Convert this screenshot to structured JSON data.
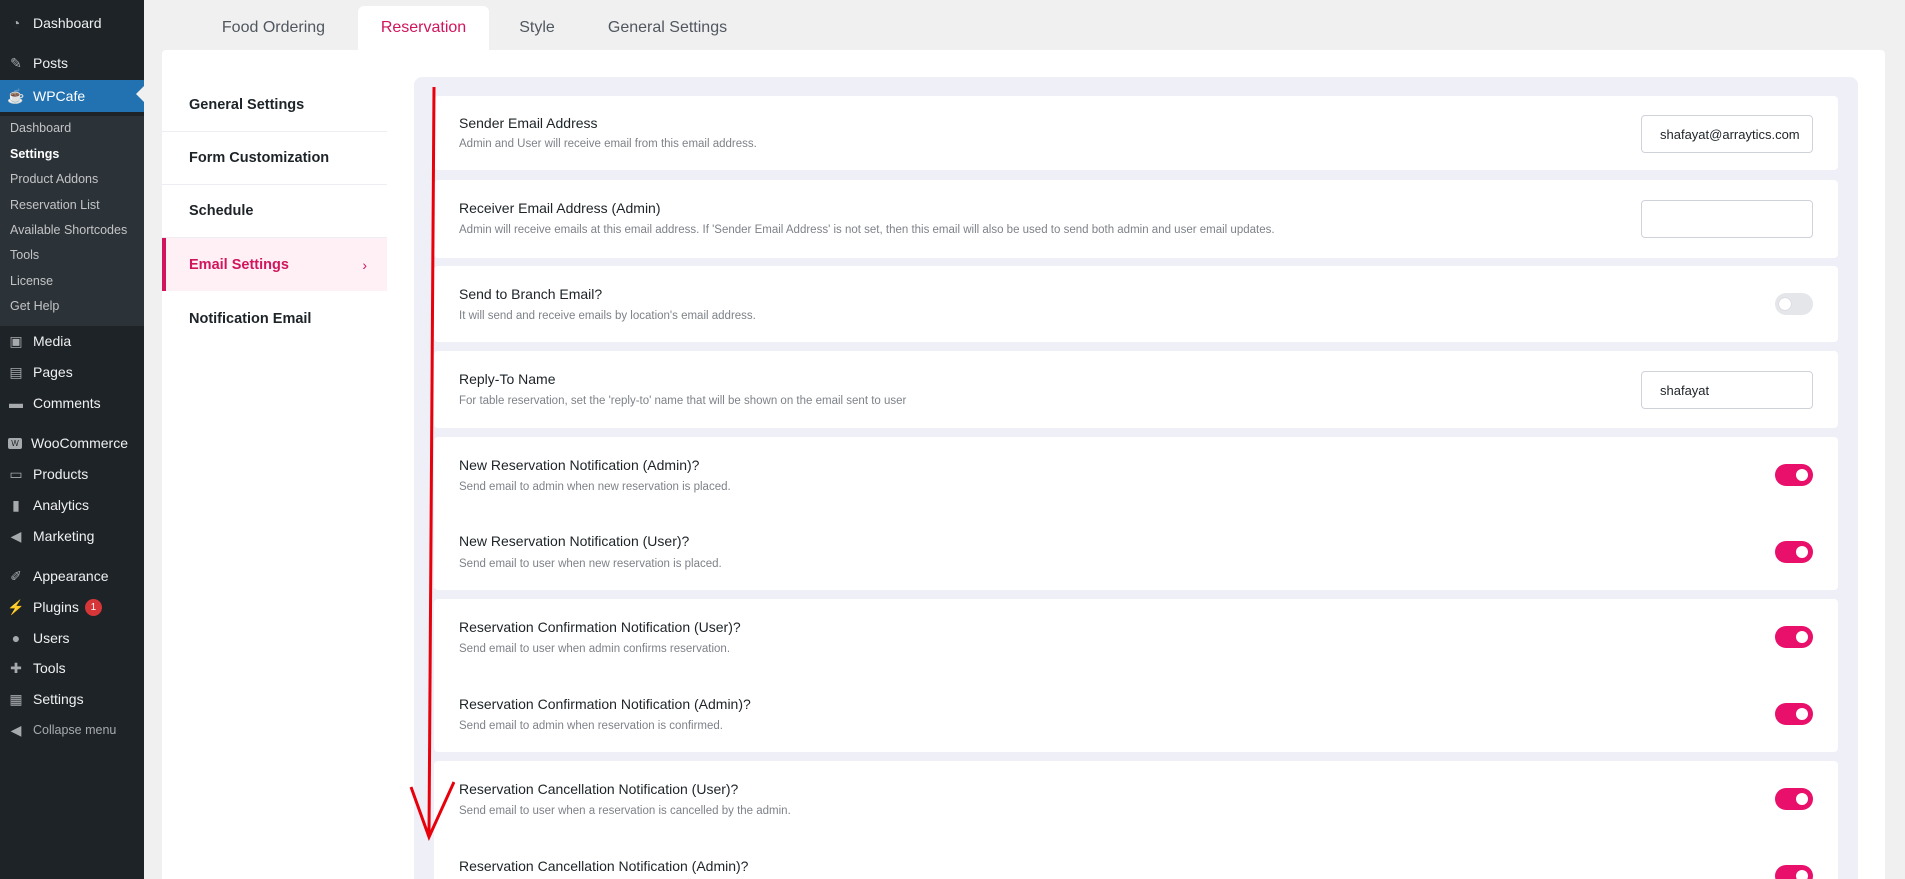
{
  "admin_menu": {
    "dashboard": "Dashboard",
    "posts": "Posts",
    "wpcafe": "WPCafe",
    "wpcafe_submenu": [
      "Dashboard",
      "Settings",
      "Product Addons",
      "Reservation List",
      "Available Shortcodes",
      "Tools",
      "License",
      "Get Help"
    ],
    "media": "Media",
    "pages": "Pages",
    "comments": "Comments",
    "woocommerce": "WooCommerce",
    "products": "Products",
    "analytics": "Analytics",
    "marketing": "Marketing",
    "appearance": "Appearance",
    "plugins": "Plugins",
    "plugins_badge": "1",
    "users": "Users",
    "tools": "Tools",
    "settings": "Settings",
    "collapse": "Collapse menu"
  },
  "tabs": [
    "Food Ordering",
    "Reservation",
    "Style",
    "General Settings"
  ],
  "settings_nav": [
    "General Settings",
    "Form Customization",
    "Schedule",
    "Email Settings",
    "Notification Email"
  ],
  "settings_nav_chevron": "›",
  "fields": {
    "sender_email": {
      "title": "Sender Email Address",
      "desc": "Admin and User will receive email from this email address.",
      "value": "shafayat@arraytics.com"
    },
    "receiver_email": {
      "title": "Receiver Email Address (Admin)",
      "desc": "Admin will receive emails at this email address. If 'Sender Email Address' is not set, then this email will also be used to send both admin and user email updates.",
      "value": ""
    },
    "branch_email": {
      "title": "Send to Branch Email?",
      "desc": "It will send and receive emails by location's email address.",
      "enabled": false
    },
    "reply_to": {
      "title": "Reply-To Name",
      "desc": "For table reservation, set the 'reply-to' name that will be shown on the email sent to user",
      "value": "shafayat"
    },
    "new_res_admin": {
      "title": "New Reservation Notification (Admin)?",
      "desc": "Send email to admin when new reservation is placed.",
      "enabled": true
    },
    "new_res_user": {
      "title": "New Reservation Notification (User)?",
      "desc": "Send email to user when new reservation is placed.",
      "enabled": true
    },
    "confirm_user": {
      "title": "Reservation Confirmation Notification (User)?",
      "desc": "Send email to user when admin confirms reservation.",
      "enabled": true
    },
    "confirm_admin": {
      "title": "Reservation Confirmation Notification (Admin)?",
      "desc": "Send email to admin when reservation is confirmed.",
      "enabled": true
    },
    "cancel_user": {
      "title": "Reservation Cancellation Notification (User)?",
      "desc": "Send email to user when a reservation is cancelled by the admin.",
      "enabled": true
    },
    "cancel_admin": {
      "title": "Reservation Cancellation Notification (Admin)?",
      "enabled": true
    }
  },
  "colors": {
    "accent": "#d0155c",
    "toggle_on": "#e8106b",
    "wp_sidebar": "#1d2327",
    "wp_current": "#2271b1",
    "annotation_arrow": "#e8000b"
  }
}
